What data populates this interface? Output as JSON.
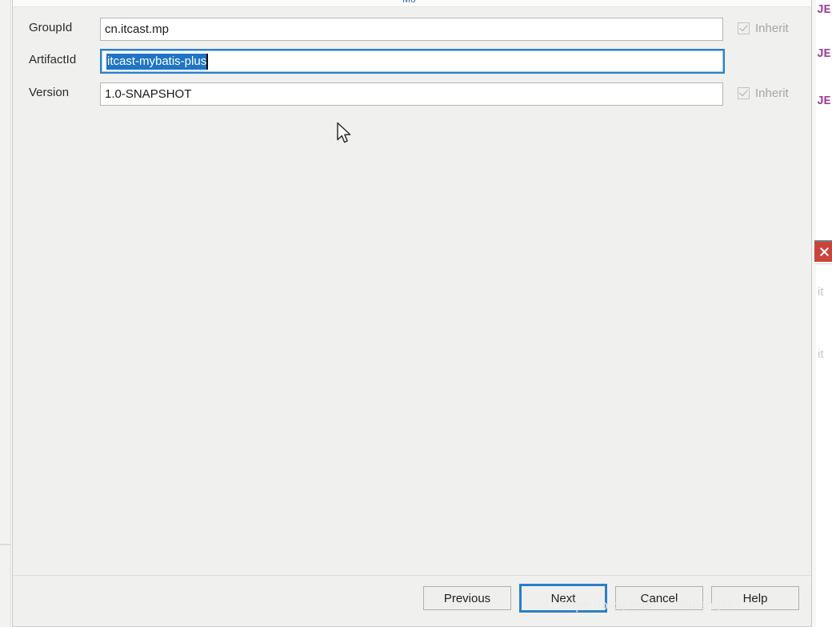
{
  "dialog": {
    "title_fragment": "Mo",
    "form": {
      "rows": [
        {
          "label": "GroupId",
          "value": "cn.itcast.mp",
          "inherit_label": "Inherit",
          "inherit_checked": true,
          "focused": false
        },
        {
          "label": "ArtifactId",
          "value": "itcast-mybatis-plus",
          "inherit_label": "",
          "inherit_checked": false,
          "focused": true
        },
        {
          "label": "Version",
          "value": "1.0-SNAPSHOT",
          "inherit_label": "Inherit",
          "inherit_checked": true,
          "focused": false
        }
      ]
    },
    "buttons": {
      "previous": "Previous",
      "next": "Next",
      "cancel": "Cancel",
      "help": "Help"
    }
  },
  "background": {
    "code_fragments": [
      "JE",
      "JE",
      "JE"
    ],
    "faint_fragments": [
      "it",
      "it"
    ],
    "close_icon": "close-icon"
  },
  "watermark": "https://blog.csdn.net/liulang68",
  "colors": {
    "accent_blue": "#2a7fc9",
    "selection_blue": "#1f74c4",
    "close_red": "#c9453c",
    "dialog_bg": "#f0f0ee",
    "keyword_purple": "#9d3f9d"
  }
}
